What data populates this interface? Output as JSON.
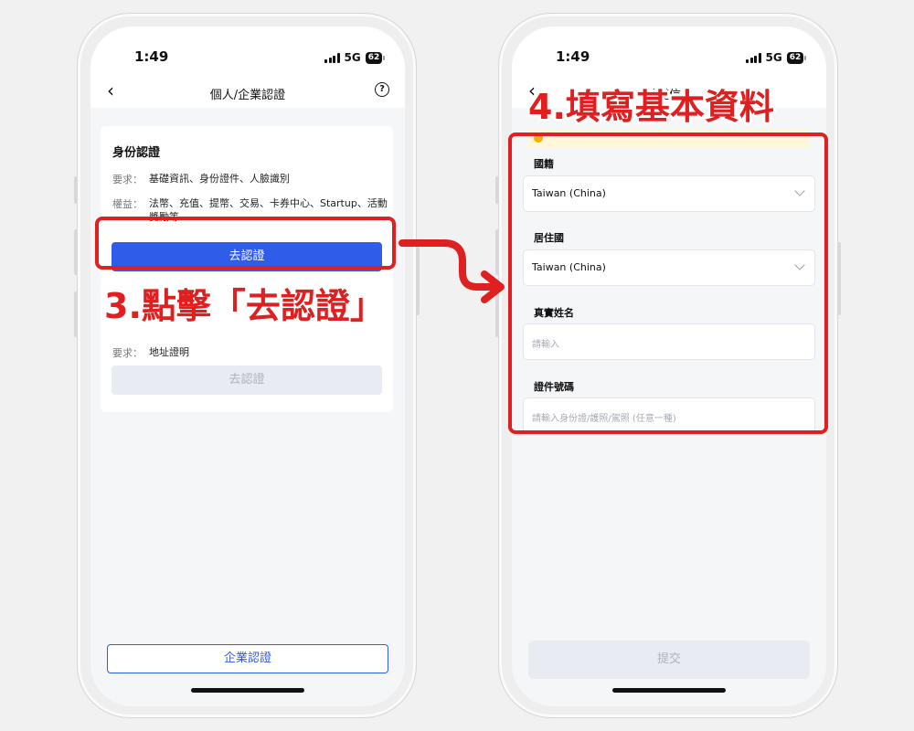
{
  "left_phone": {
    "status": {
      "time": "1:49",
      "network": "5G",
      "battery": "62"
    },
    "nav": {
      "title": "個人/企業認證",
      "help": "?"
    },
    "personal": {
      "title": "身份認證",
      "req_label": "要求：",
      "req_value": "基礎資訊、身份證件、人臉識別",
      "rights_label": "權益：",
      "rights_value": "法幣、充值、提幣、交易、卡券中心、Startup、活動獎勵等",
      "button": "去認證"
    },
    "address": {
      "req_label": "要求：",
      "req_value": "地址證明",
      "button": "去認證"
    },
    "enterprise_button": "企業認證"
  },
  "right_phone": {
    "status": {
      "time": "1:49",
      "network": "5G",
      "battery": "62"
    },
    "nav": {
      "title": "基礎信息"
    },
    "fields": [
      {
        "label": "國籍",
        "value": "Taiwan (China)",
        "placeholder": ""
      },
      {
        "label": "居住國",
        "value": "Taiwan (China)",
        "placeholder": ""
      },
      {
        "label": "真實姓名",
        "value": "",
        "placeholder": "請輸入"
      },
      {
        "label": "證件號碼",
        "value": "",
        "placeholder": "請輸入身份證/護照/駕照 (任意一種)"
      }
    ],
    "submit": "提交"
  },
  "annotations": {
    "step3": "3.點擊「去認證」",
    "step4": "4.填寫基本資料"
  },
  "colors": {
    "accent": "#2f5ce8",
    "annotation": "#e02020"
  }
}
